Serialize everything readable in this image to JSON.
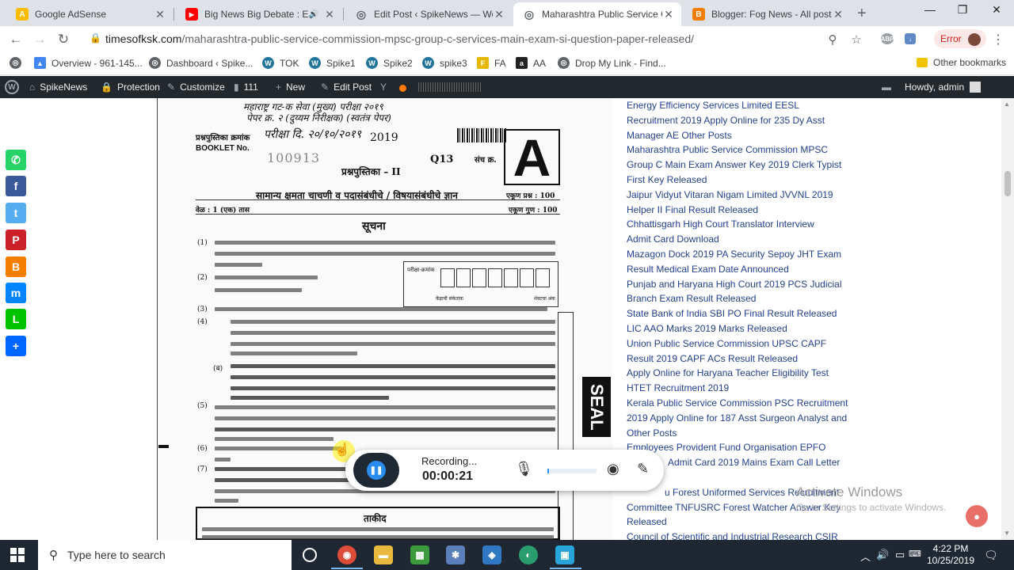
{
  "browser": {
    "tabs": [
      {
        "title": "Google AdSense",
        "icon": "adsense-icon",
        "color": "#fbbc04",
        "glyph": "A",
        "active": false
      },
      {
        "title": "Big News Big Debate : Elect",
        "icon": "youtube-icon",
        "color": "#ff0000",
        "glyph": "▶",
        "active": false
      },
      {
        "title": "Edit Post ‹ SpikeNews — Word",
        "icon": "globe-icon",
        "color": "#5f6368",
        "glyph": "◎",
        "active": false
      },
      {
        "title": "Maharashtra Public Service Co",
        "icon": "globe-icon",
        "color": "#5f6368",
        "glyph": "◎",
        "active": true
      },
      {
        "title": "Blogger: Fog News - All posts",
        "icon": "blogger-icon",
        "color": "#f57d00",
        "glyph": "B",
        "active": false
      }
    ],
    "url_domain": "timesofksk.com",
    "url_path": "/maharashtra-public-service-commission-mpsc-group-c-services-main-exam-si-question-paper-released/",
    "error_label": "Error",
    "bookmarks": [
      {
        "label": "",
        "icon": "chrome-apps-icon",
        "color": "#5f6368",
        "glyph": "◎"
      },
      {
        "label": "Overview - 961-145...",
        "icon": "google-ads-icon",
        "color": "#4285f4",
        "glyph": "▲"
      },
      {
        "label": "Dashboard ‹ Spike...",
        "icon": "globe-icon",
        "color": "#5f6368",
        "glyph": "◎"
      },
      {
        "label": "TOK",
        "icon": "wordpress-icon",
        "color": "#21759b",
        "glyph": "W"
      },
      {
        "label": "Spike1",
        "icon": "wordpress-icon",
        "color": "#21759b",
        "glyph": "W"
      },
      {
        "label": "Spike2",
        "icon": "wordpress-icon",
        "color": "#21759b",
        "glyph": "W"
      },
      {
        "label": "spike3",
        "icon": "wordpress-icon",
        "color": "#21759b",
        "glyph": "W"
      },
      {
        "label": "FA",
        "icon": "fa-icon",
        "color": "#e6b800",
        "glyph": "F"
      },
      {
        "label": "AA",
        "icon": "amazon-icon",
        "color": "#222222",
        "glyph": "a"
      },
      {
        "label": "Drop My Link - Find...",
        "icon": "globe-icon",
        "color": "#5f6368",
        "glyph": "◎"
      }
    ],
    "other_bookmarks": "Other bookmarks"
  },
  "wp_admin": {
    "site_name": "SpikeNews",
    "protection": "Protection",
    "customize": "Customize",
    "comments_count": "111",
    "new_label": "New",
    "edit_post": "Edit Post",
    "howdy": "Howdy, admin"
  },
  "paper": {
    "header_hand1": "महाराष्ट्र गट-क सेवा (मुख्य) परीक्षा २०१९",
    "header_hand2": "पेपर क्र. २ (दुय्यम निरीक्षक) (स्वतंत्र पेपर)",
    "booklet_label_mr": "प्रश्नपुस्तिका क्रमांक",
    "exam_date": "परीक्षा दि. २०/१०/२०१९",
    "year": "2019",
    "booklet_label_en": "BOOKLET No.",
    "booklet_no": "100913",
    "booklet_title": "प्रश्नपुस्तिका – II",
    "code": "Q13",
    "set_label": "संच क्र.",
    "set_letter": "A",
    "subject": "सामान्य क्षमता चाचणी व पदासंबंधीचे / विषयासंबंधीचे ज्ञान",
    "total_questions": "एकूण प्रश्न : 100",
    "time": "वेळ : 1 (एक) तास",
    "total_marks": "एकूण गुण : 100",
    "instructions_heading": "सूचना",
    "item_numbers": [
      "(1)",
      "(2)",
      "(3)",
      "(4)",
      "(ब)",
      "(5)",
      "(6)",
      "(7)"
    ],
    "numbox_label": "परीक्षा-क्रमांक",
    "numbox_center": "केंद्राची संकेतांक",
    "numbox_last": "शेवटचा अंक",
    "seal_text": "SEAL",
    "warning_heading": "ताकीद"
  },
  "sidebar_links": [
    "Energy Efficiency Services Limited EESL",
    "Recruitment 2019 Apply Online for 235 Dy Asst",
    "Manager AE Other Posts",
    "Maharashtra Public Service Commission MPSC",
    "Group C Main Exam Answer Key 2019 Clerk Typist",
    "First Key Released",
    "Jaipur Vidyut Vitaran Nigam Limited JVVNL 2019",
    "Helper II Final Result Released",
    "Chhattisgarh High Court Translator Interview",
    "Admit Card Download",
    "Mazagon Dock 2019 PA Security Sepoy JHT Exam",
    "Result Medical Exam Date Announced",
    "Punjab and Haryana High Court 2019 PCS Judicial",
    "Branch Exam Result Released",
    "State Bank of India SBI PO Final Result Released",
    "LIC AAO Marks 2019 Marks Released",
    "Union Public Service Commission UPSC CAPF",
    "Result 2019 CAPF ACs Result Released",
    "Apply Online for Haryana Teacher Eligibility Test",
    "HTET Recruitment 2019",
    "Kerala Public Service Commission PSC Recruitment",
    "2019 Apply Online for 187 Asst Surgeon Analyst and",
    "Other Posts",
    "Employees Provident Fund Organisation EPFO",
    "Admit Card 2019 Mains Exam Call Letter",
    "",
    "u Forest Uniformed Services Recruitment",
    "Committee TNFUSRC Forest Watcher Answer Key",
    "Released",
    "Council of Scientific and Industrial Research CSIR"
  ],
  "share_buttons": [
    {
      "name": "whatsapp-icon",
      "color": "#25d366",
      "glyph": "✆"
    },
    {
      "name": "facebook-icon",
      "color": "#3b5998",
      "glyph": "f"
    },
    {
      "name": "twitter-icon",
      "color": "#55acee",
      "glyph": "t"
    },
    {
      "name": "pinterest-icon",
      "color": "#cb2027",
      "glyph": "P"
    },
    {
      "name": "blogger-icon",
      "color": "#f57d00",
      "glyph": "B"
    },
    {
      "name": "messenger-icon",
      "color": "#0084ff",
      "glyph": "m"
    },
    {
      "name": "line-icon",
      "color": "#00c300",
      "glyph": "L"
    },
    {
      "name": "share-icon",
      "color": "#0166ff",
      "glyph": "+"
    }
  ],
  "activate_windows": {
    "title": "Activate Windows",
    "subtitle": "Go to Settings to activate Windows."
  },
  "recorder": {
    "status": "Recording...",
    "time": "00:00:21"
  },
  "taskbar": {
    "search_placeholder": "Type here to search",
    "time": "4:22 PM",
    "date": "10/25/2019"
  }
}
